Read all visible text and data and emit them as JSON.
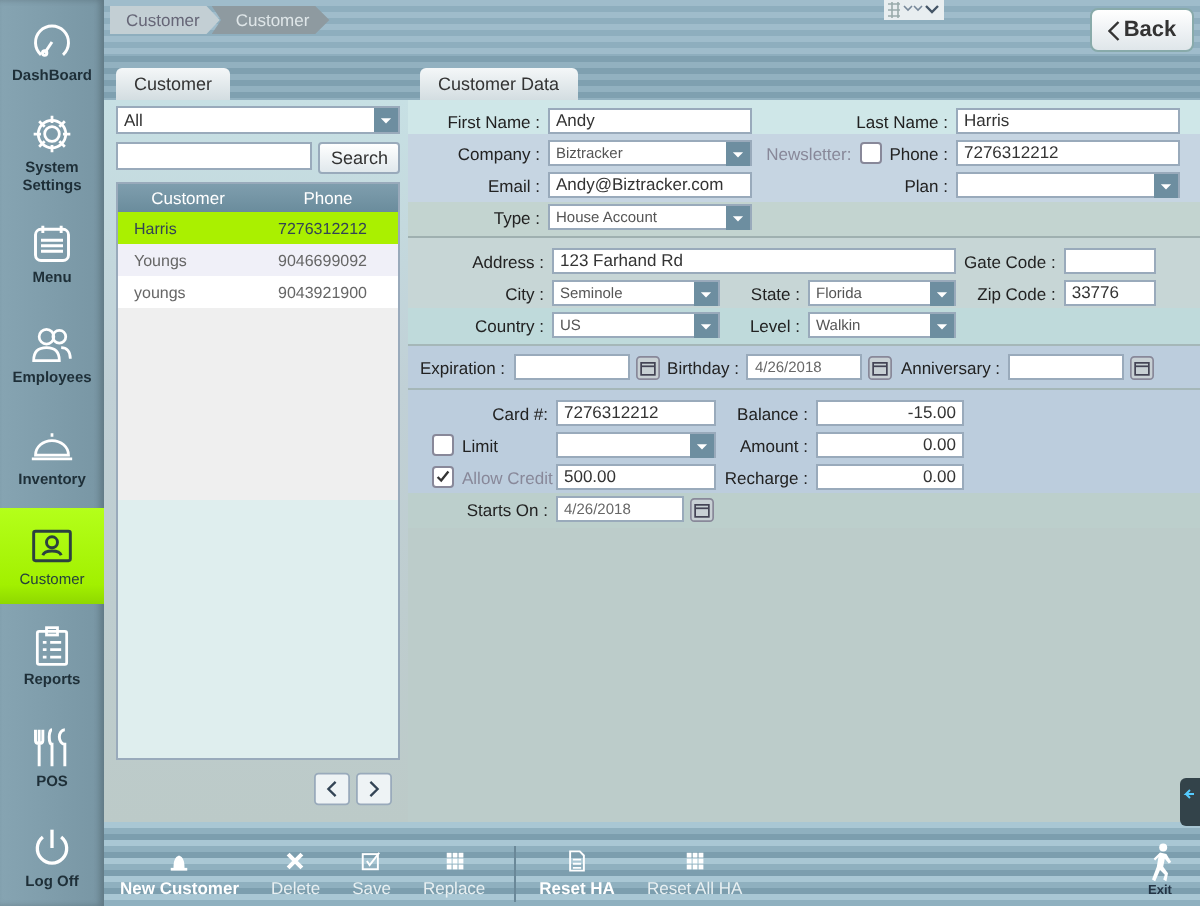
{
  "breadcrumb": [
    {
      "label": "Customer",
      "selected": false
    },
    {
      "label": "Customer",
      "selected": true
    }
  ],
  "back_button": "Back",
  "sidebar": {
    "items": [
      {
        "label": "DashBoard",
        "kind": "gauge",
        "selected": false
      },
      {
        "label": "System Settings",
        "kind": "gear",
        "selected": false
      },
      {
        "label": "Menu",
        "kind": "calendar",
        "selected": false
      },
      {
        "label": "Employees",
        "kind": "people",
        "selected": false
      },
      {
        "label": "Inventory",
        "kind": "cloche",
        "selected": false
      },
      {
        "label": "Customer",
        "kind": "contact",
        "selected": true
      },
      {
        "label": "Reports",
        "kind": "clipboard",
        "selected": false
      },
      {
        "label": "POS",
        "kind": "utensils",
        "selected": false
      },
      {
        "label": "Log Off",
        "kind": "power",
        "selected": false
      }
    ]
  },
  "customer_list": {
    "tab": "Customer",
    "filter": "All",
    "search_button": "Search",
    "table": {
      "columns": [
        "Customer",
        "Phone"
      ],
      "rows": [
        {
          "cells": [
            "Harris",
            "7276312212"
          ],
          "selected": true
        },
        {
          "cells": [
            "Youngs",
            "9046699092"
          ],
          "selected": false
        },
        {
          "cells": [
            "youngs",
            "9043921900"
          ],
          "selected": false
        }
      ]
    }
  },
  "customer_data": {
    "tab": "Customer Data",
    "sections": [
      {
        "kind": "contact",
        "rows": [
          [
            {
              "label": "First Name :",
              "kind": "text",
              "value": "Andy"
            },
            {
              "label": "Last Name :",
              "kind": "text",
              "value": "Harris"
            }
          ],
          [
            {
              "label": "Company :",
              "kind": "select",
              "value": "Biztracker"
            },
            {
              "label": "Phone :",
              "kind": "text",
              "value": "7276312212",
              "newsletter": {
                "label": "Newsletter:",
                "checked": false,
                "disabled": true
              }
            }
          ],
          [
            {
              "label": "Email :",
              "kind": "text",
              "value": "Andy@Biztracker.com"
            },
            {
              "label": "Plan :",
              "kind": "select"
            }
          ],
          [
            {
              "label": "Type :",
              "kind": "select",
              "value": "House Account"
            }
          ]
        ]
      },
      {
        "kind": "address",
        "rows": [
          [
            {
              "label": "Address :",
              "kind": "text",
              "value": "123 Farhand Rd"
            },
            "",
            {
              "label": "Gate Code :",
              "kind": "text"
            }
          ],
          [
            {
              "label": "City :",
              "kind": "select",
              "value": "Seminole"
            },
            {
              "label": "State :",
              "kind": "select",
              "value": "Florida"
            },
            {
              "label": "Zip Code :",
              "kind": "text",
              "value": "33776"
            }
          ],
          [
            {
              "label": "Country :",
              "kind": "select",
              "value": "US"
            },
            {
              "label": "Level :",
              "kind": "select",
              "value": "Walkin"
            }
          ]
        ]
      },
      {
        "kind": "dates",
        "rows": [
          [
            {
              "label": "Expiration :",
              "kind": "date"
            },
            {
              "label": "Birthday :",
              "kind": "date",
              "value": "4/26/2018"
            },
            {
              "label": "Anniversary :",
              "kind": "date"
            }
          ]
        ]
      },
      {
        "kind": "account",
        "rows": [
          [
            {
              "label": "Card #:",
              "kind": "text",
              "value": "7276312212"
            },
            {
              "label": "Balance :",
              "kind": "amount",
              "value": "-15.00"
            }
          ],
          [
            {
              "label": "Limit",
              "kind": "select",
              "check": {
                "checked": false,
                "disabled": false
              }
            },
            {
              "label": "Amount :",
              "kind": "amount",
              "value": "0.00"
            }
          ],
          [
            {
              "label": "Allow Credit",
              "kind": "text",
              "value": "500.00",
              "check": {
                "checked": true,
                "disabled": true
              }
            },
            {
              "label": "Recharge :",
              "kind": "amount",
              "value": "0.00"
            }
          ],
          [
            {
              "label": "Starts On :",
              "kind": "date",
              "value": "4/26/2018"
            }
          ]
        ]
      }
    ]
  },
  "toolbar": {
    "groups": [
      [
        {
          "label": "New Customer",
          "kind": "bell",
          "bold": true
        },
        {
          "label": "Delete",
          "kind": "cross",
          "bold": false
        },
        {
          "label": "Save",
          "kind": "check",
          "bold": false
        },
        {
          "label": "Replace",
          "kind": "grid",
          "bold": false
        }
      ],
      [
        {
          "label": "Reset HA",
          "kind": "document",
          "bold": true
        },
        {
          "label": "Reset All HA",
          "kind": "grid",
          "bold": false
        }
      ]
    ],
    "exit": "Exit"
  }
}
